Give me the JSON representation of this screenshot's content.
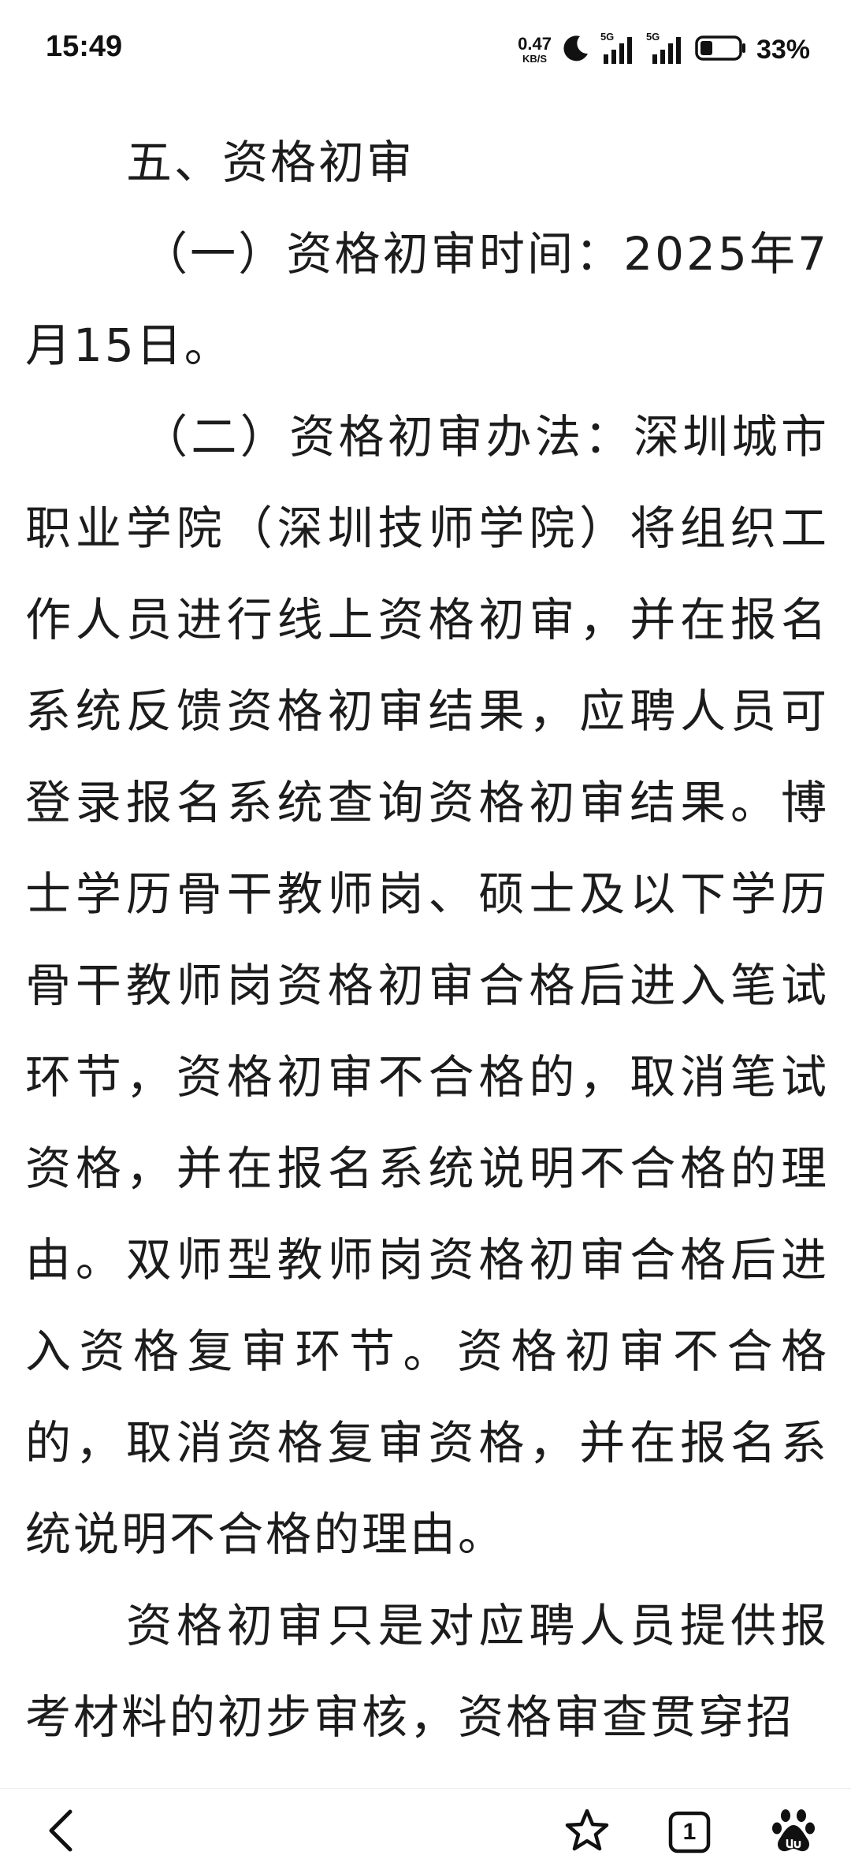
{
  "status_bar": {
    "time": "15:49",
    "net_speed_value": "0.47",
    "net_speed_unit": "KB/S",
    "sim1_type": "5G",
    "sim2_type": "5G",
    "battery_percent": "33%",
    "battery_level": 0.33,
    "icons": [
      "moon-icon",
      "signal-icon",
      "signal-icon",
      "battery-icon"
    ]
  },
  "article": {
    "paragraphs": [
      "五、资格初审",
      "（一）资格初审时间：2025年7月15日。",
      "（二）资格初审办法：深圳城市职业学院（深圳技师学院）将组织工作人员进行线上资格初审，并在报名系统反馈资格初审结果，应聘人员可登录报名系统查询资格初审结果。博士学历骨干教师岗、硕士及以下学历骨干教师岗资格初审合格后进入笔试环节，资格初审不合格的，取消笔试资格，并在报名系统说明不合格的理由。双师型教师岗资格初审合格后进入资格复审环节。资格初审不合格的，取消资格复审资格，并在报名系统说明不合格的理由。",
      "资格初审只是对应聘人员提供报考材料的初步审核，资格审查贯穿招"
    ]
  },
  "bottom_bar": {
    "tab_count": "1",
    "icons": [
      "back-arrow-icon",
      "star-icon",
      "tabs-icon",
      "paw-icon"
    ]
  }
}
